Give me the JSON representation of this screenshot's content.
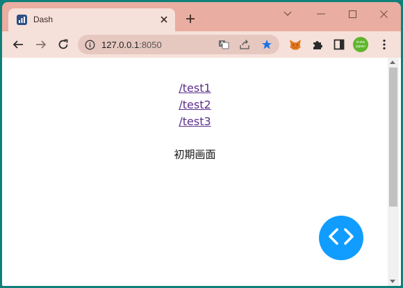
{
  "browser": {
    "tab": {
      "title": "Dash",
      "favicon": "dash-chart-icon"
    },
    "address_bar": {
      "host": "127.0.0.1",
      "port": ":8050"
    },
    "profile_avatar": {
      "line1": "insta",
      "line2": "japan"
    }
  },
  "page": {
    "links": [
      {
        "label": "/test1"
      },
      {
        "label": "/test2"
      },
      {
        "label": "/test3"
      }
    ],
    "status_text": "初期画面"
  },
  "colors": {
    "tab_strip": "#e9ada1",
    "toolbar": "#f6e0da",
    "link": "#5b2f8a",
    "fab": "#119dff",
    "star": "#1a73e8",
    "avatar": "#5fb52b"
  },
  "icons": {
    "fab": "code-brackets-icon",
    "star": "star-icon",
    "extensions": [
      "metamask-fox-icon",
      "puzzle-icon",
      "side-panel-icon",
      "kebab-menu-icon"
    ]
  }
}
